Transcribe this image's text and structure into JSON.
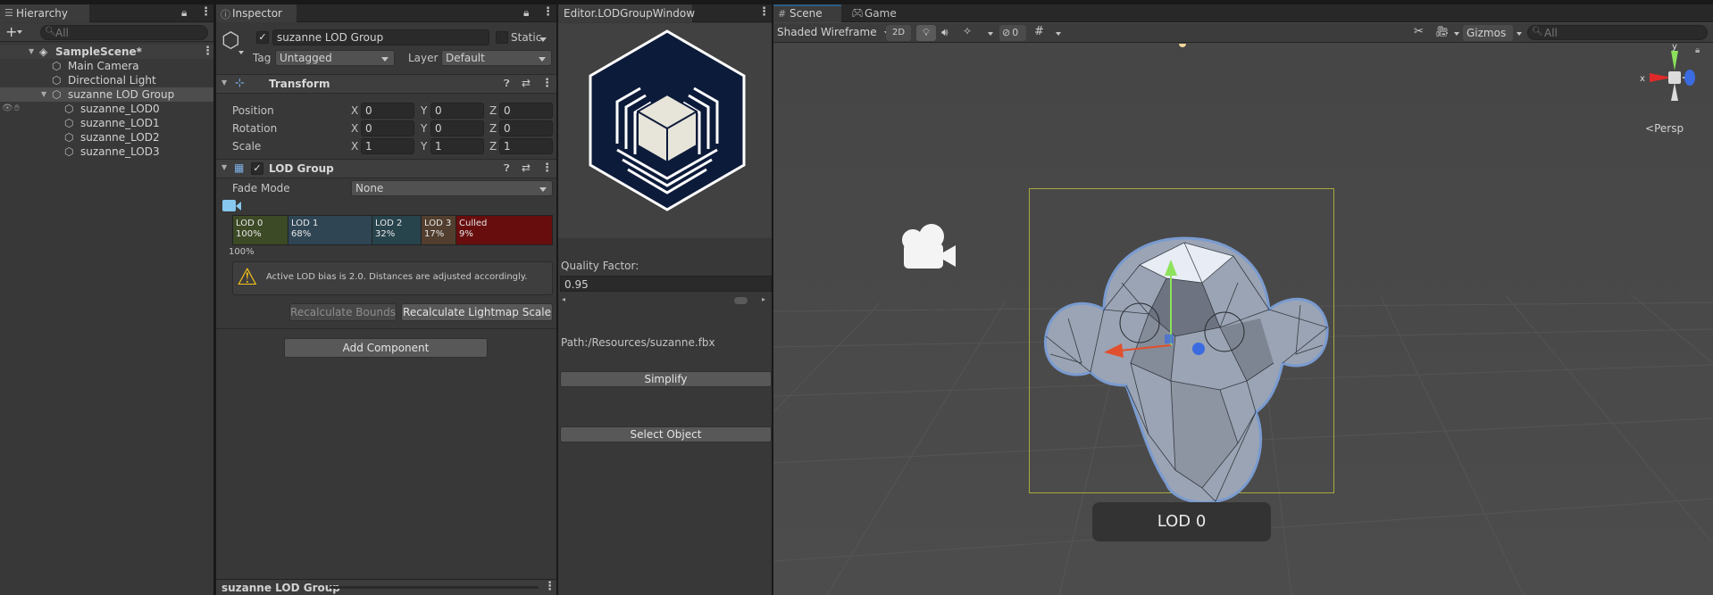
{
  "hierarchy": {
    "tab_label": "Hierarchy",
    "add_label": "+",
    "search_placeholder": "All",
    "scene_name": "SampleScene*",
    "items": [
      "Main Camera",
      "Directional Light",
      "suzanne LOD Group",
      "suzanne_LOD0",
      "suzanne_LOD1",
      "suzanne_LOD2",
      "suzanne_LOD3"
    ]
  },
  "inspector": {
    "tab_label": "Inspector",
    "object_name": "suzanne LOD Group",
    "static_label": "Static",
    "tag_label": "Tag",
    "tag_value": "Untagged",
    "layer_label": "Layer",
    "layer_value": "Default",
    "transform": {
      "title": "Transform",
      "rows": [
        {
          "label": "Position",
          "x": "0",
          "y": "0",
          "z": "0"
        },
        {
          "label": "Rotation",
          "x": "0",
          "y": "0",
          "z": "0"
        },
        {
          "label": "Scale",
          "x": "1",
          "y": "1",
          "z": "1"
        }
      ],
      "axis_x": "X",
      "axis_y": "Y",
      "axis_z": "Z"
    },
    "lod_group": {
      "title": "LOD Group",
      "fade_mode_label": "Fade Mode",
      "fade_mode_value": "None",
      "segments": [
        {
          "name": "LOD 0",
          "percent": "100%",
          "color": "#3c4a26"
        },
        {
          "name": "LOD 1",
          "percent": "68%",
          "color": "#2f4554"
        },
        {
          "name": "LOD 2",
          "percent": "32%",
          "color": "#27434c"
        },
        {
          "name": "LOD 3",
          "percent": "17%",
          "color": "#513e2e"
        },
        {
          "name": "Culled",
          "percent": "9%",
          "color": "#670d0d"
        }
      ],
      "marker_percent": "100%",
      "warning": "Active LOD bias is 2.0. Distances are adjusted accordingly.",
      "recalc_bounds": "Recalculate Bounds",
      "recalc_lightmap": "Recalculate Lightmap Scale"
    },
    "add_component": "Add Component",
    "footer_label": "suzanne LOD Group"
  },
  "lod_window": {
    "tab_label": "Editor.LODGroupWindow",
    "quality_label": "Quality Factor:",
    "quality_value": "0.95",
    "path_text": "Path:/Resources/suzanne.fbx",
    "simplify_label": "Simplify",
    "select_label": "Select Object"
  },
  "scene": {
    "tab_scene": "Scene",
    "tab_game": "Game",
    "shading_mode": "Shaded Wireframe",
    "mode_2d": "2D",
    "hidden_count": "0",
    "gizmos_label": "Gizmos",
    "search_placeholder": "All",
    "persp_label": "Persp",
    "lod_label": "LOD 0",
    "axis_x": "x",
    "axis_y": "y"
  },
  "colors": {
    "accent": "#2c5d87",
    "selection": "#4d4d4d",
    "panel_bg": "#383838",
    "logo_navy": "#0d1b3a"
  }
}
